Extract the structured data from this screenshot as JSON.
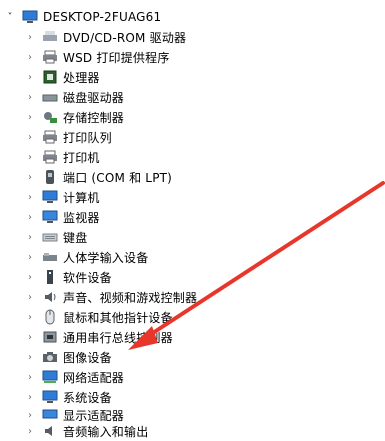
{
  "root": {
    "label": "DESKTOP-2FUAG61",
    "expanded_glyph": "˅"
  },
  "items": [
    {
      "label": "DVD/CD-ROM 驱动器",
      "icon": "dvd-drive-icon"
    },
    {
      "label": "WSD 打印提供程序",
      "icon": "printer-icon"
    },
    {
      "label": "处理器",
      "icon": "processor-icon"
    },
    {
      "label": "磁盘驱动器",
      "icon": "disk-drive-icon"
    },
    {
      "label": "存储控制器",
      "icon": "storage-controller-icon"
    },
    {
      "label": "打印队列",
      "icon": "print-queue-icon"
    },
    {
      "label": "打印机",
      "icon": "printer-icon"
    },
    {
      "label": "端口 (COM 和 LPT)",
      "icon": "port-icon"
    },
    {
      "label": "计算机",
      "icon": "computer-icon"
    },
    {
      "label": "监视器",
      "icon": "monitor-icon"
    },
    {
      "label": "键盘",
      "icon": "keyboard-icon"
    },
    {
      "label": "人体学输入设备",
      "icon": "hid-icon"
    },
    {
      "label": "软件设备",
      "icon": "software-device-icon"
    },
    {
      "label": "声音、视频和游戏控制器",
      "icon": "sound-icon"
    },
    {
      "label": "鼠标和其他指针设备",
      "icon": "mouse-icon"
    },
    {
      "label": "通用串行总线控制器",
      "icon": "usb-icon"
    },
    {
      "label": "图像设备",
      "icon": "camera-icon"
    },
    {
      "label": "网络适配器",
      "icon": "network-adapter-icon"
    },
    {
      "label": "系统设备",
      "icon": "system-device-icon"
    },
    {
      "label": "显示适配器",
      "icon": "display-adapter-icon"
    },
    {
      "label": "音频输入和输出",
      "icon": "audio-io-icon"
    }
  ],
  "collapsed_glyph": "›",
  "colors": {
    "arrow": "#e8362b",
    "chevron": "#6d6d6d",
    "icon_blue": "#2f7bd6"
  }
}
